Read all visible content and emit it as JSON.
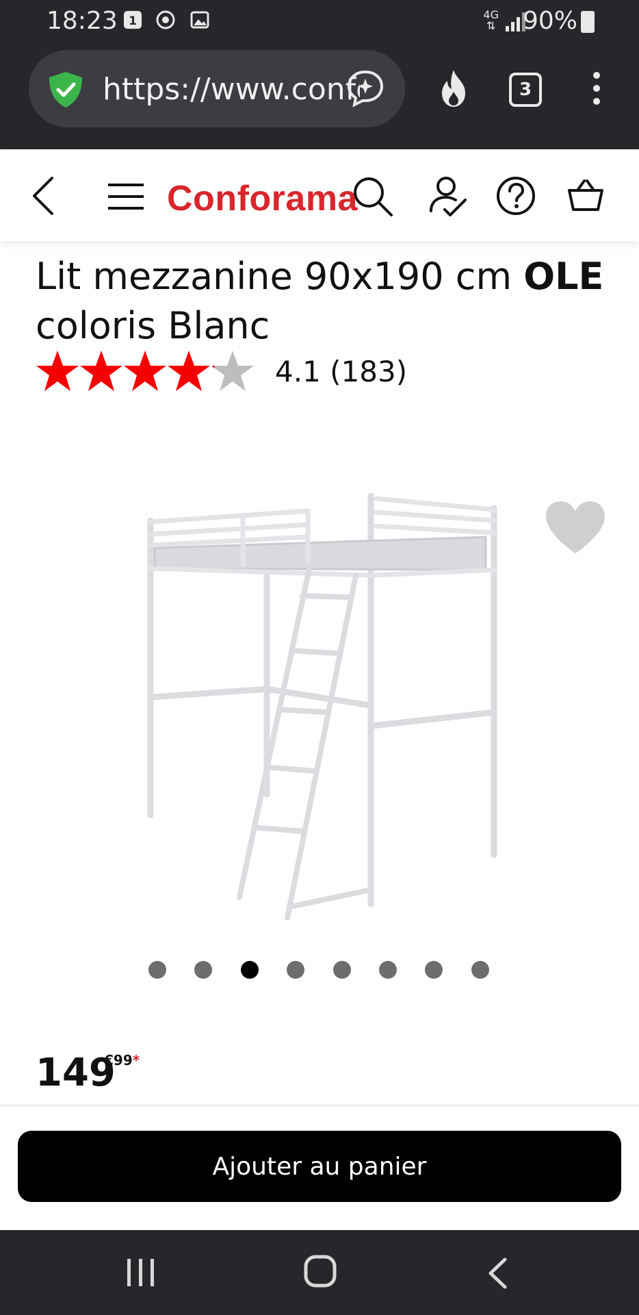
{
  "status_bar": {
    "time": "18:23",
    "notification_badge": "1",
    "network": "4G",
    "battery": "90%"
  },
  "browser": {
    "url": "https://www.conforama.fr",
    "tab_count": "3"
  },
  "site": {
    "logo": "Conforama",
    "brand_color": "#d8262c"
  },
  "product": {
    "title_prefix": "Lit mezzanine 90x190 cm ",
    "title_bold": "OLE",
    "title_suffix": " coloris Blanc",
    "rating_value": 4.1,
    "rating_text": "4.1 (183)",
    "price_main": "149",
    "price_cents": "€99",
    "price_asterisk": "*",
    "image_count": 8,
    "active_image_index": 2
  },
  "actions": {
    "add_to_cart": "Ajouter au panier"
  }
}
